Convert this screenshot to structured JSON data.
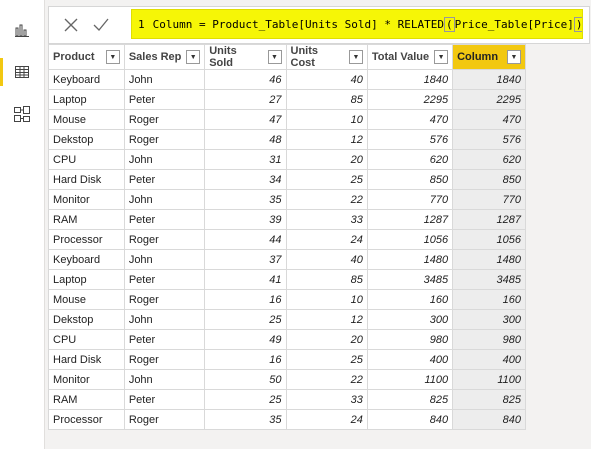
{
  "formula": {
    "line_number": "1",
    "text_before": "Column = Product_Table[Units Sold] * RELATED",
    "open_paren": "(",
    "text_inside": "Price_Table[Price]",
    "close_paren": ")"
  },
  "table": {
    "headers": [
      "Product",
      "Sales Rep",
      "Units Sold",
      "Units Cost",
      "Total Value",
      "Column"
    ],
    "rows": [
      [
        "Keyboard",
        "John",
        "46",
        "40",
        "1840",
        "1840"
      ],
      [
        "Laptop",
        "Peter",
        "27",
        "85",
        "2295",
        "2295"
      ],
      [
        "Mouse",
        "Roger",
        "47",
        "10",
        "470",
        "470"
      ],
      [
        "Dekstop",
        "Roger",
        "48",
        "12",
        "576",
        "576"
      ],
      [
        "CPU",
        "John",
        "31",
        "20",
        "620",
        "620"
      ],
      [
        "Hard Disk",
        "Peter",
        "34",
        "25",
        "850",
        "850"
      ],
      [
        "Monitor",
        "John",
        "35",
        "22",
        "770",
        "770"
      ],
      [
        "RAM",
        "Peter",
        "39",
        "33",
        "1287",
        "1287"
      ],
      [
        "Processor",
        "Roger",
        "44",
        "24",
        "1056",
        "1056"
      ],
      [
        "Keyboard",
        "John",
        "37",
        "40",
        "1480",
        "1480"
      ],
      [
        "Laptop",
        "Peter",
        "41",
        "85",
        "3485",
        "3485"
      ],
      [
        "Mouse",
        "Roger",
        "16",
        "10",
        "160",
        "160"
      ],
      [
        "Dekstop",
        "John",
        "25",
        "12",
        "300",
        "300"
      ],
      [
        "CPU",
        "Peter",
        "49",
        "20",
        "980",
        "980"
      ],
      [
        "Hard Disk",
        "Roger",
        "16",
        "25",
        "400",
        "400"
      ],
      [
        "Monitor",
        "John",
        "50",
        "22",
        "1100",
        "1100"
      ],
      [
        "RAM",
        "Peter",
        "25",
        "33",
        "825",
        "825"
      ],
      [
        "Processor",
        "Roger",
        "35",
        "24",
        "840",
        "840"
      ]
    ]
  },
  "colors": {
    "formula_highlight": "#f6f606",
    "active_column_header": "#f2c811",
    "active_column_cells": "#ededed"
  },
  "icons": [
    "report-view-icon",
    "data-view-icon",
    "model-view-icon",
    "cancel-icon",
    "commit-check-icon",
    "dropdown-arrow-icon"
  ]
}
